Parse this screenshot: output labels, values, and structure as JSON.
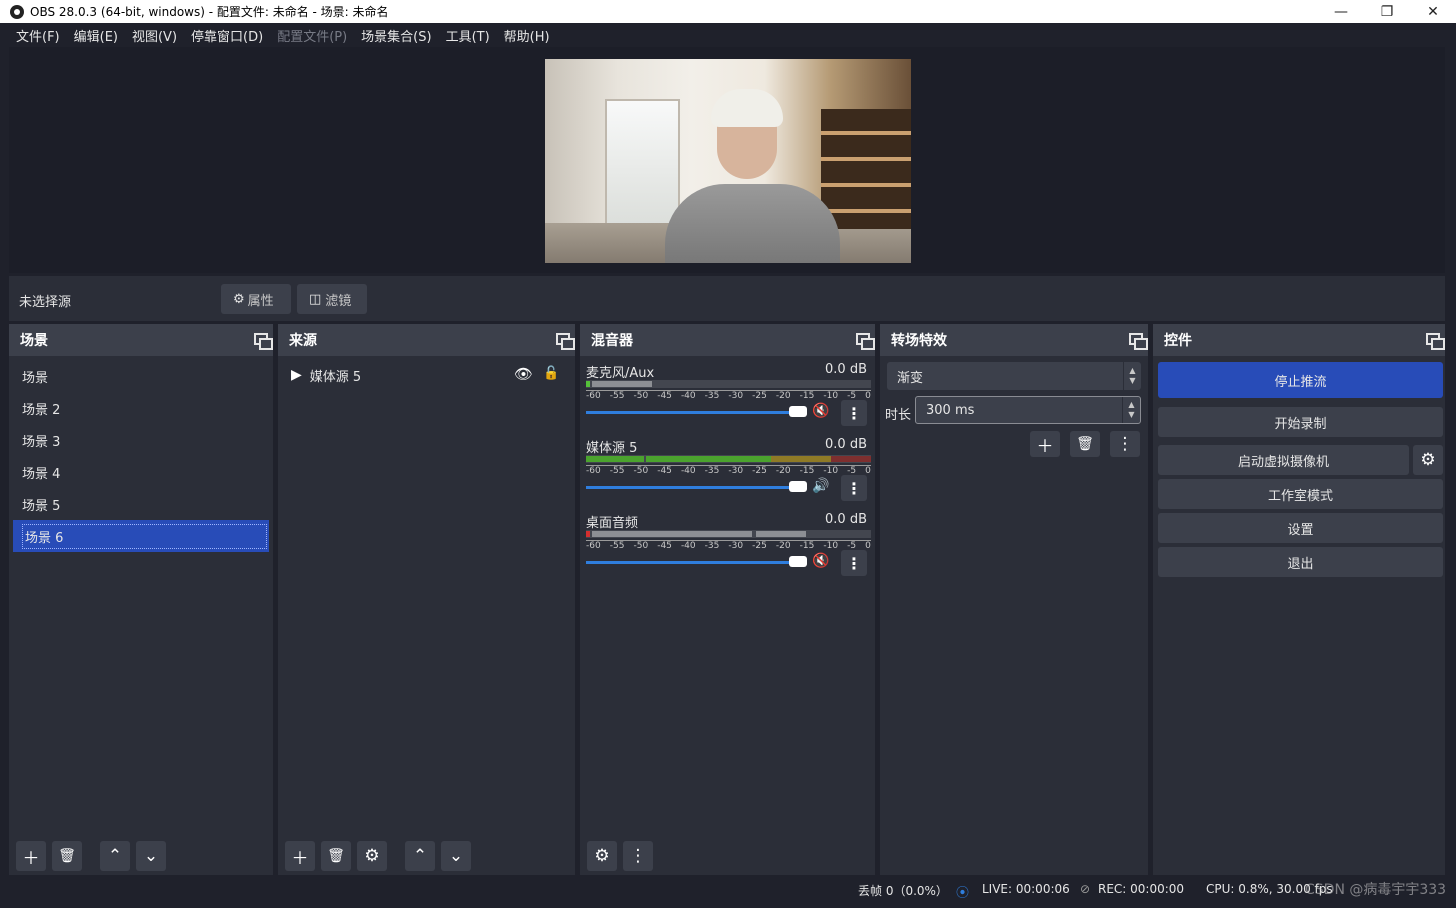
{
  "window": {
    "title": "OBS 28.0.3 (64-bit, windows) - 配置文件: 未命名 - 场景: 未命名"
  },
  "menu": [
    {
      "label": "文件(F)",
      "enabled": true
    },
    {
      "label": "编辑(E)",
      "enabled": true
    },
    {
      "label": "视图(V)",
      "enabled": true
    },
    {
      "label": "停靠窗口(D)",
      "enabled": true
    },
    {
      "label": "配置文件(P)",
      "enabled": false
    },
    {
      "label": "场景集合(S)",
      "enabled": true
    },
    {
      "label": "工具(T)",
      "enabled": true
    },
    {
      "label": "帮助(H)",
      "enabled": true
    }
  ],
  "context": {
    "no_source": "未选择源",
    "properties": "属性",
    "filters": "滤镜"
  },
  "scenes": {
    "title": "场景",
    "items": [
      "场景",
      "场景 2",
      "场景 3",
      "场景 4",
      "场景 5",
      "场景 6"
    ],
    "selected": "场景 6"
  },
  "sources": {
    "title": "来源",
    "items": [
      {
        "name": "媒体源 5"
      }
    ]
  },
  "mixer": {
    "title": "混音器",
    "scale": [
      "-60",
      "-55",
      "-50",
      "-45",
      "-40",
      "-35",
      "-30",
      "-25",
      "-20",
      "-15",
      "-10",
      "-5",
      "0"
    ],
    "channels": [
      {
        "name": "麦克风/Aux",
        "db": "0.0 dB",
        "muted": true
      },
      {
        "name": "媒体源 5",
        "db": "0.0 dB",
        "muted": false
      },
      {
        "name": "桌面音频",
        "db": "0.0 dB",
        "muted": true
      }
    ]
  },
  "transitions": {
    "title": "转场特效",
    "selected": "渐变",
    "duration_label": "时长",
    "duration_value": "300 ms"
  },
  "controls": {
    "title": "控件",
    "stop_stream": "停止推流",
    "start_record": "开始录制",
    "virtual_cam": "启动虚拟摄像机",
    "studio_mode": "工作室模式",
    "settings": "设置",
    "exit": "退出"
  },
  "status": {
    "dropped": "丢帧 0（0.0%）",
    "live": "LIVE: 00:00:06",
    "rec": "REC: 00:00:00",
    "cpu": "CPU: 0.8%, 30.00 fps",
    "watermark": "CSDN @病毒宇宇333"
  },
  "colors": {
    "accent": "#284cb8",
    "panel": "#2b2e38",
    "header": "#3c404b",
    "mute": "#d42f2f"
  }
}
